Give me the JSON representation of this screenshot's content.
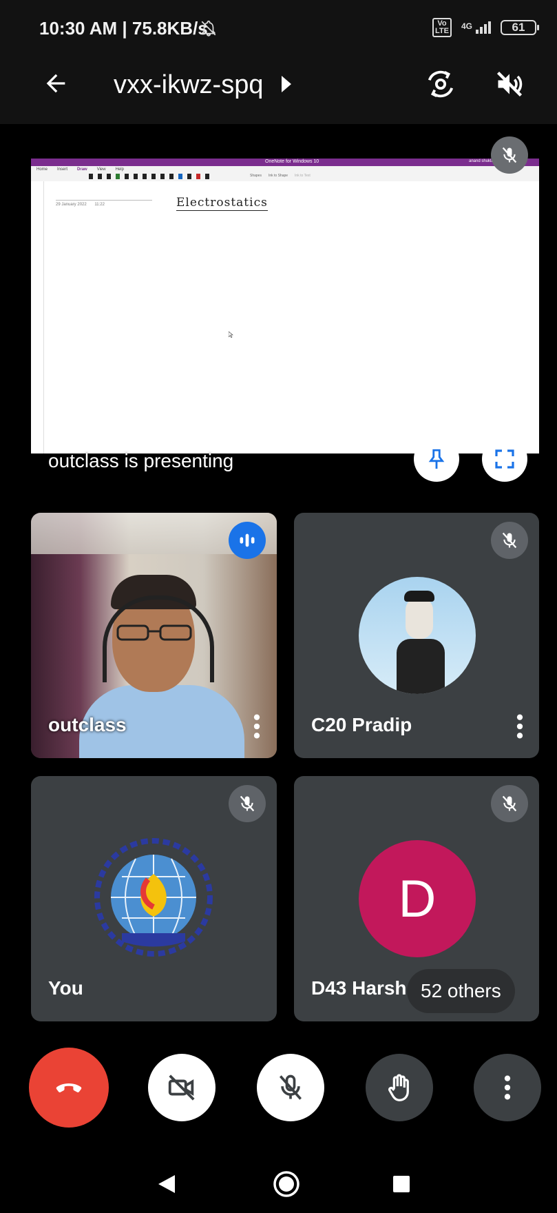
{
  "status_bar": {
    "time": "10:30 AM | 75.8KB/s",
    "volte": "Vo LTE",
    "network": "4G",
    "battery": "61"
  },
  "header": {
    "meeting_code": "vxx-ikwz-spq"
  },
  "presentation": {
    "app_title": "OneNote for Windows 10",
    "account": "anand shukla",
    "menu": [
      "Home",
      "Insert",
      "Draw",
      "View",
      "Help"
    ],
    "ribbon_extra": [
      "Shapes",
      "Ink to Shape",
      "Ink to Text"
    ],
    "page_date": "29 January 2022",
    "page_time": "11:22",
    "note_title": "Electrostatics",
    "caption": "outclass is presenting"
  },
  "participants": [
    {
      "name": "outclass"
    },
    {
      "name": "C20 Pradip"
    },
    {
      "name": "You"
    },
    {
      "name": "D43 Harsh",
      "initial": "D",
      "avatar_color": "#c2185b"
    }
  ],
  "others_badge": "52 others",
  "colors": {
    "accent_blue": "#1a73e8",
    "end_call_red": "#ea4335",
    "tile_bg": "#3c4043"
  }
}
